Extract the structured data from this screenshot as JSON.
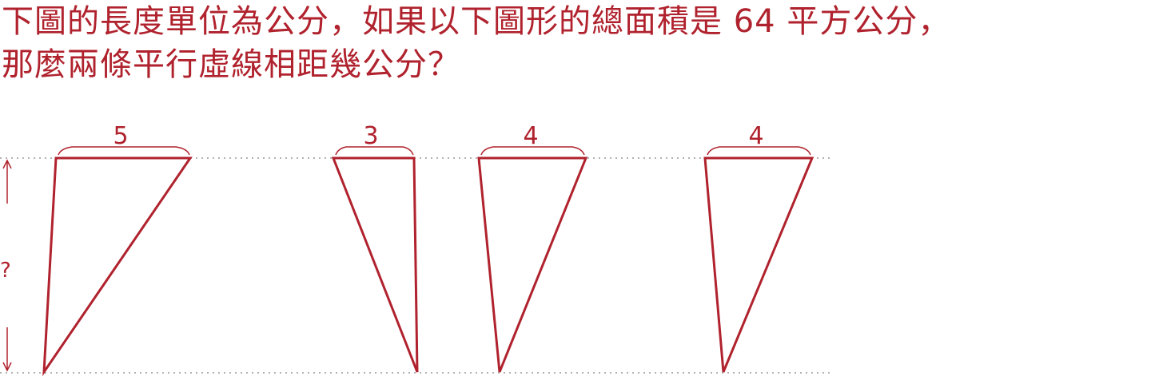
{
  "question": {
    "line1": "下圖的長度單位為公分，如果以下圖形的總面積是 64 平方公分，",
    "line2": "那麼兩條平行虛線相距幾公分？"
  },
  "figure": {
    "triangle_top_lengths": [
      "5",
      "3",
      "4",
      "4"
    ],
    "height_label": "?"
  },
  "colors": {
    "ink": "#b0222d",
    "dotted_line": "#999999"
  }
}
